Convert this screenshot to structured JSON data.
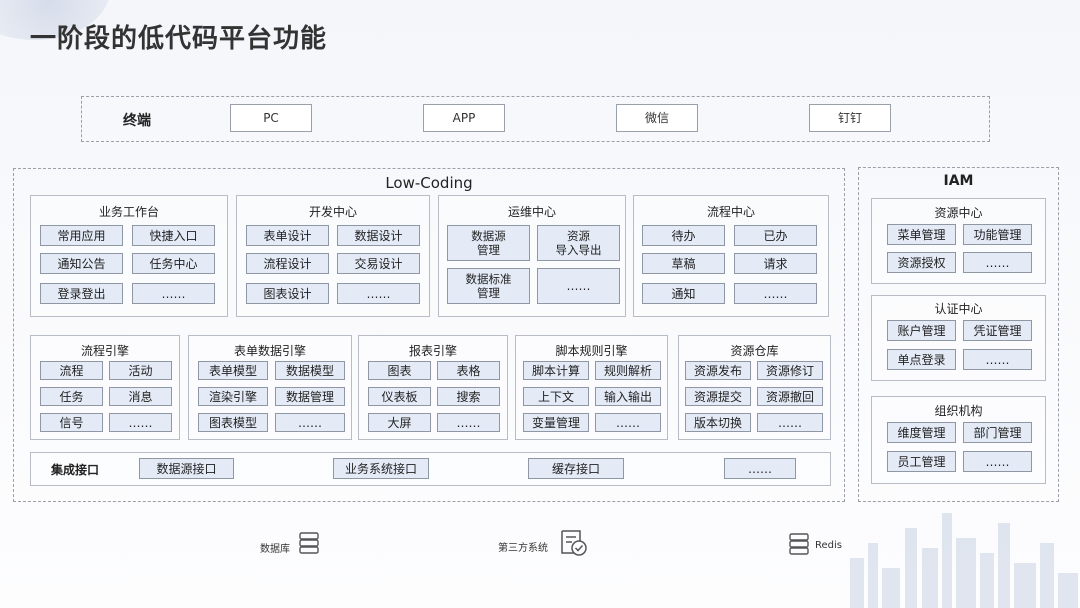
{
  "title": "一阶段的低代码平台功能",
  "terminal": {
    "label": "终端",
    "items": [
      "PC",
      "APP",
      "微信",
      "钉钉"
    ]
  },
  "low_coding": {
    "title": "Low-Coding",
    "top_sections": [
      {
        "title": "业务工作台",
        "items": [
          "常用应用",
          "快捷入口",
          "通知公告",
          "任务中心",
          "登录登出",
          "……"
        ]
      },
      {
        "title": "开发中心",
        "items": [
          "表单设计",
          "数据设计",
          "流程设计",
          "交易设计",
          "图表设计",
          "……"
        ]
      },
      {
        "title": "运维中心",
        "items": [
          "数据源\n管理",
          "资源\n导入导出",
          "数据标准\n管理",
          "……"
        ]
      },
      {
        "title": "流程中心",
        "items": [
          "待办",
          "已办",
          "草稿",
          "请求",
          "通知",
          "……"
        ]
      }
    ],
    "engines": [
      {
        "title": "流程引擎",
        "items": [
          "流程",
          "活动",
          "任务",
          "消息",
          "信号",
          "……"
        ]
      },
      {
        "title": "表单数据引擎",
        "items": [
          "表单模型",
          "数据模型",
          "渲染引擎",
          "数据管理",
          "图表模型",
          "……"
        ]
      },
      {
        "title": "报表引擎",
        "items": [
          "图表",
          "表格",
          "仪表板",
          "搜索",
          "大屏",
          "……"
        ]
      },
      {
        "title": "脚本规则引擎",
        "items": [
          "脚本计算",
          "规则解析",
          "上下文",
          "输入输出",
          "变量管理",
          "……"
        ]
      },
      {
        "title": "资源仓库",
        "items": [
          "资源发布",
          "资源修订",
          "资源提交",
          "资源撤回",
          "版本切换",
          "……"
        ]
      }
    ],
    "integration": {
      "label": "集成接口",
      "items": [
        "数据源接口",
        "业务系统接口",
        "缓存接口",
        "……"
      ]
    }
  },
  "iam": {
    "title": "IAM",
    "sections": [
      {
        "title": "资源中心",
        "items": [
          "菜单管理",
          "功能管理",
          "资源授权",
          "……"
        ]
      },
      {
        "title": "认证中心",
        "items": [
          "账户管理",
          "凭证管理",
          "单点登录",
          "……"
        ]
      },
      {
        "title": "组织机构",
        "items": [
          "维度管理",
          "部门管理",
          "员工管理",
          "……"
        ]
      }
    ]
  },
  "bottom": [
    {
      "label": "数据库",
      "icon": "database-icon"
    },
    {
      "label": "第三方系统",
      "icon": "third-party-system-icon"
    },
    {
      "label": "Redis",
      "icon": "redis-server-icon"
    }
  ],
  "colors": {
    "chip_fill": "#e4ebf7",
    "chip_border": "#8f97a5",
    "frame_border": "#9aa0aa",
    "title_text": "#333333"
  }
}
